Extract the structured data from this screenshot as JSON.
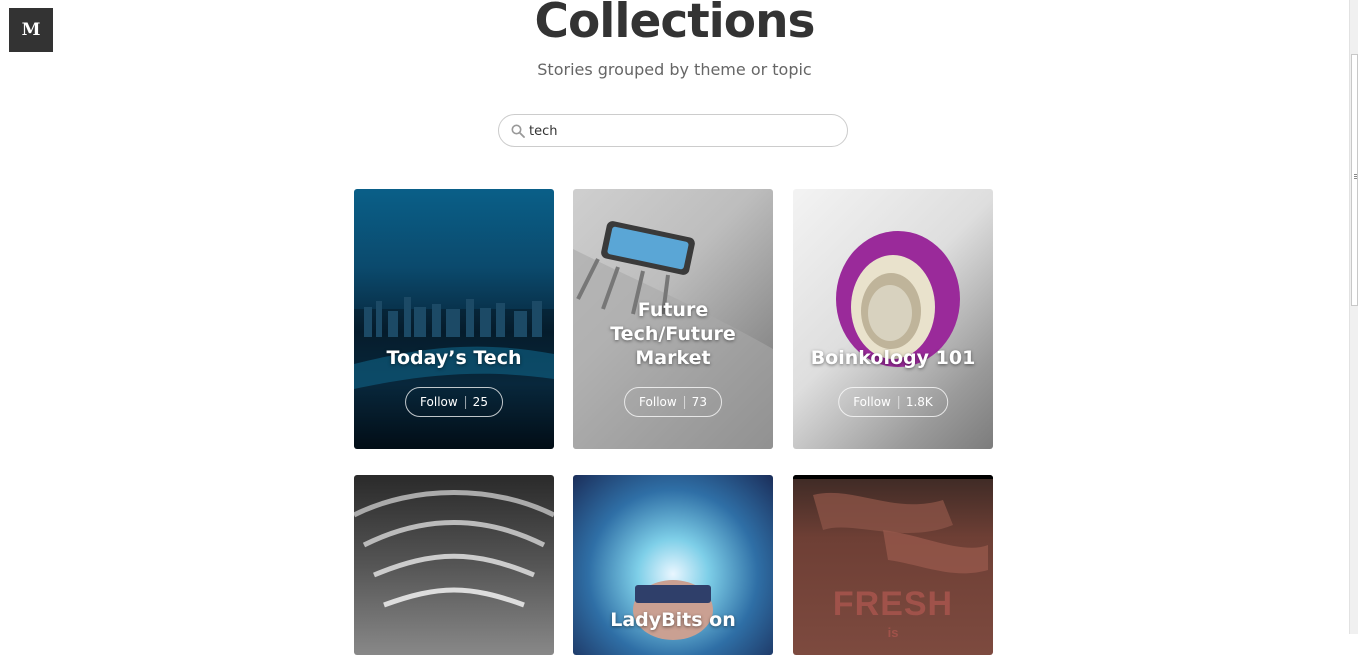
{
  "logo": {
    "letter": "M"
  },
  "header": {
    "title": "Collections",
    "subtitle": "Stories grouped by theme or topic"
  },
  "search": {
    "value": "tech",
    "icon": "search-icon"
  },
  "collections": [
    {
      "title": "Today’s Tech",
      "follow_label": "Follow",
      "followers": "25"
    },
    {
      "title": "Future Tech/Future Market",
      "follow_label": "Follow",
      "followers": "73"
    },
    {
      "title": "Boinkology 101",
      "follow_label": "Follow",
      "followers": "1.8K"
    },
    {
      "title": "",
      "follow_label": "",
      "followers": ""
    },
    {
      "title": "LadyBits on",
      "follow_label": "",
      "followers": ""
    },
    {
      "title": "",
      "follow_label": "",
      "followers": "",
      "cover_text": "FRESH",
      "cover_sub": "is"
    }
  ]
}
